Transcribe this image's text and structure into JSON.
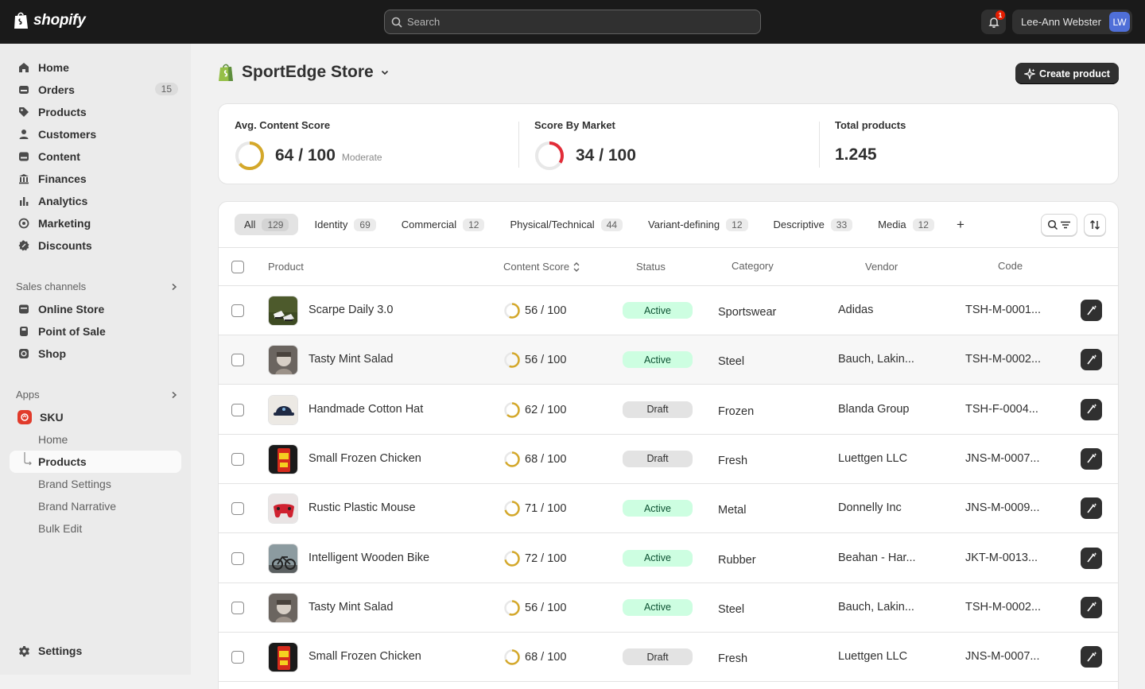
{
  "topbar": {
    "logo_text": "shopify",
    "search_placeholder": "Search",
    "notification_count": "1",
    "user_name": "Lee-Ann Webster",
    "user_initials": "LW"
  },
  "sidebar": {
    "items": [
      {
        "label": "Home",
        "icon": "home-icon"
      },
      {
        "label": "Orders",
        "icon": "orders-icon",
        "count": "15"
      },
      {
        "label": "Products",
        "icon": "tag-icon"
      },
      {
        "label": "Customers",
        "icon": "person-icon"
      },
      {
        "label": "Content",
        "icon": "content-icon"
      },
      {
        "label": "Finances",
        "icon": "bank-icon"
      },
      {
        "label": "Analytics",
        "icon": "bar-chart-icon"
      },
      {
        "label": "Marketing",
        "icon": "target-icon"
      },
      {
        "label": "Discounts",
        "icon": "discount-icon"
      }
    ],
    "sales_channels_label": "Sales channels",
    "sales_channels": [
      {
        "label": "Online Store",
        "icon": "store-icon"
      },
      {
        "label": "Point of Sale",
        "icon": "pos-icon"
      },
      {
        "label": "Shop",
        "icon": "shop-icon"
      }
    ],
    "apps_label": "Apps",
    "app_name": "SKU",
    "app_items": [
      "Home",
      "Products",
      "Brand Settings",
      "Brand Narrative",
      "Bulk Edit"
    ],
    "settings_label": "Settings"
  },
  "header": {
    "store_name": "SportEdge Store",
    "create_button": "Create product"
  },
  "stats": {
    "avg_label": "Avg. Content Score",
    "avg_value": "64 / 100",
    "avg_level": "Moderate",
    "avg_fraction": 0.64,
    "market_label": "Score By Market",
    "market_value": "34 / 100",
    "market_fraction": 0.34,
    "total_label": "Total products",
    "total_value": "1.245"
  },
  "tabs": [
    {
      "label": "All",
      "count": "129"
    },
    {
      "label": "Identity",
      "count": "69"
    },
    {
      "label": "Commercial",
      "count": "12"
    },
    {
      "label": "Physical/Technical",
      "count": "44"
    },
    {
      "label": "Variant-defining",
      "count": "12"
    },
    {
      "label": "Descriptive",
      "count": "33"
    },
    {
      "label": "Media",
      "count": "12"
    }
  ],
  "columns": {
    "product": "Product",
    "content_score": "Content Score",
    "status": "Status",
    "category": "Category",
    "vendor": "Vendor",
    "code": "Code"
  },
  "rows": [
    {
      "name": "Scarpe Daily 3.0",
      "score": "56 / 100",
      "score_fraction": 0.56,
      "status": "Active",
      "category": "Sportswear",
      "vendor": "Adidas",
      "code": "TSH-M-0001...",
      "thumb": "shoes"
    },
    {
      "name": "Tasty Mint Salad",
      "score": "56 / 100",
      "score_fraction": 0.56,
      "status": "Active",
      "category": "Steel",
      "vendor": "Bauch, Lakin...",
      "code": "TSH-M-0002...",
      "thumb": "person"
    },
    {
      "name": "Handmade Cotton Hat",
      "score": "62 / 100",
      "score_fraction": 0.62,
      "status": "Draft",
      "category": "Frozen",
      "vendor": "Blanda Group",
      "code": "TSH-F-0004...",
      "thumb": "hat"
    },
    {
      "name": "Small Frozen Chicken",
      "score": "68 / 100",
      "score_fraction": 0.68,
      "status": "Draft",
      "category": "Fresh",
      "vendor": "Luettgen LLC",
      "code": "JNS-M-0007...",
      "thumb": "snack"
    },
    {
      "name": "Rustic Plastic Mouse",
      "score": "71 / 100",
      "score_fraction": 0.71,
      "status": "Active",
      "category": "Metal",
      "vendor": "Donnelly Inc",
      "code": "JNS-M-0009...",
      "thumb": "controller"
    },
    {
      "name": "Intelligent Wooden Bike",
      "score": "72 / 100",
      "score_fraction": 0.72,
      "status": "Active",
      "category": "Rubber",
      "vendor": "Beahan - Har...",
      "code": "JKT-M-0013...",
      "thumb": "bike"
    },
    {
      "name": "Tasty Mint Salad",
      "score": "56 / 100",
      "score_fraction": 0.56,
      "status": "Active",
      "category": "Steel",
      "vendor": "Bauch, Lakin...",
      "code": "TSH-M-0002...",
      "thumb": "person"
    },
    {
      "name": "Small Frozen Chicken",
      "score": "68 / 100",
      "score_fraction": 0.68,
      "status": "Draft",
      "category": "Fresh",
      "vendor": "Luettgen LLC",
      "code": "JNS-M-0007...",
      "thumb": "snack"
    }
  ],
  "colors": {
    "topbar": "#1a1a1a",
    "score_moderate": "#d4a82a",
    "score_low": "#e22c38",
    "active_badge": "#cdfee1",
    "draft_badge": "#e3e3e3"
  }
}
